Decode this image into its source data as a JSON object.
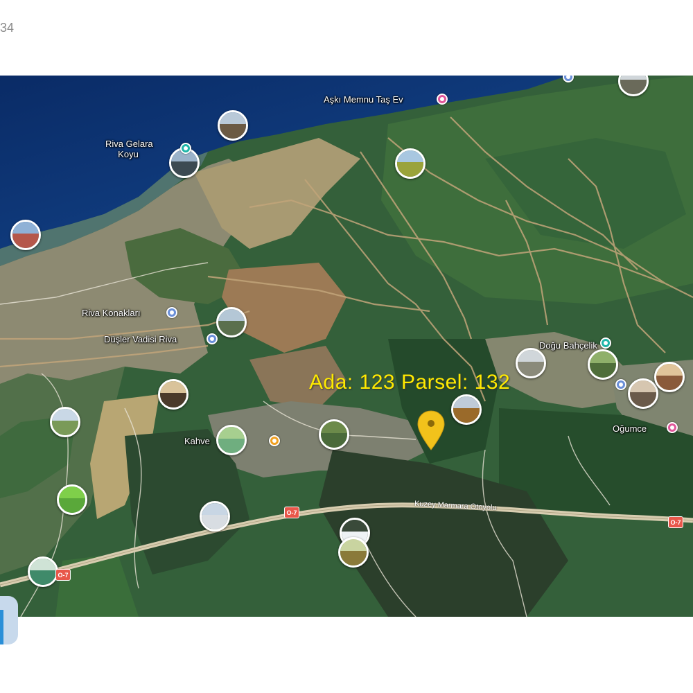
{
  "page_number": "34",
  "map": {
    "places": {
      "aski_memnu": "Aşkı Memnu Taş Ev",
      "riva_gelara_line1": "Riva Gelara",
      "riva_gelara_line2": "Koyu",
      "riva_konaklari": "Riva Konakları",
      "dusler_vadisi": "Düşler Vadisi Riva",
      "kahve": "Kahve",
      "dogu_bahcelik": "Doğu Bahçelik",
      "ogumce": "Oğumce"
    },
    "road_name": "Kuzey Marmara Otoyolu",
    "route_badge": "O-7",
    "parcel_label": "Ada: 123  Parsel: 132",
    "colors": {
      "sea": "#0b2f6b",
      "forest": "#2f5a33",
      "highway": "#d8cdb0",
      "parcel_label": "#ffea00",
      "marker": "#f2c21b",
      "pin_pink": "#e0569a",
      "pin_teal": "#1fb5a8",
      "pin_blue": "#6a8fd8",
      "pin_orange": "#f0a020"
    }
  }
}
